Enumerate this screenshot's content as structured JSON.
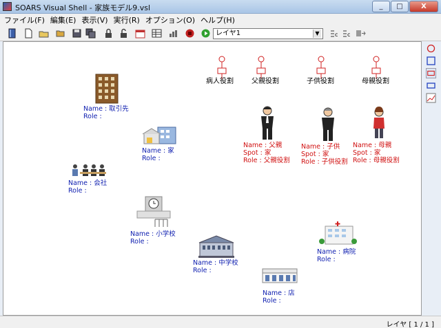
{
  "window": {
    "title": "SOARS Visual Shell - 家族モデル9.vsl",
    "min": "_",
    "max": "□",
    "close": "X"
  },
  "menu": [
    "ファイル(F)",
    "編集(E)",
    "表示(V)",
    "実行(R)",
    "オプション(O)",
    "ヘルプ(H)"
  ],
  "toolbar": {
    "layer_value": "レイヤ1"
  },
  "roles": [
    {
      "label": "病人役割"
    },
    {
      "label": "父親役割"
    },
    {
      "label": "子供役割"
    },
    {
      "label": "母親役割"
    }
  ],
  "spots": [
    {
      "name": "Name : 取引先",
      "role": "Role :"
    },
    {
      "name": "Name : 家",
      "role": "Role :"
    },
    {
      "name": "Name : 会社",
      "role": "Role :"
    },
    {
      "name": "Name : 小学校",
      "role": "Role :"
    },
    {
      "name": "Name : 中学校",
      "role": "Role :"
    },
    {
      "name": "Name : 病院",
      "role": "Role :"
    },
    {
      "name": "Name : 店",
      "role": "Role :"
    }
  ],
  "agents": [
    {
      "name": "Name : 父親",
      "spot": "Spot : 家",
      "role": "Role : 父親役割"
    },
    {
      "name": "Name : 子供",
      "spot": "Spot : 家",
      "role": "Role : 子供役割"
    },
    {
      "name": "Name : 母親",
      "spot": "Spot : 家",
      "role": "Role : 母親役割"
    }
  ],
  "status": {
    "layer": "レイヤ [ 1 / 1 ]"
  },
  "colors": {
    "spot_text": "#1020b0",
    "agent_text": "#d01010",
    "role_icon": "#d02020"
  }
}
